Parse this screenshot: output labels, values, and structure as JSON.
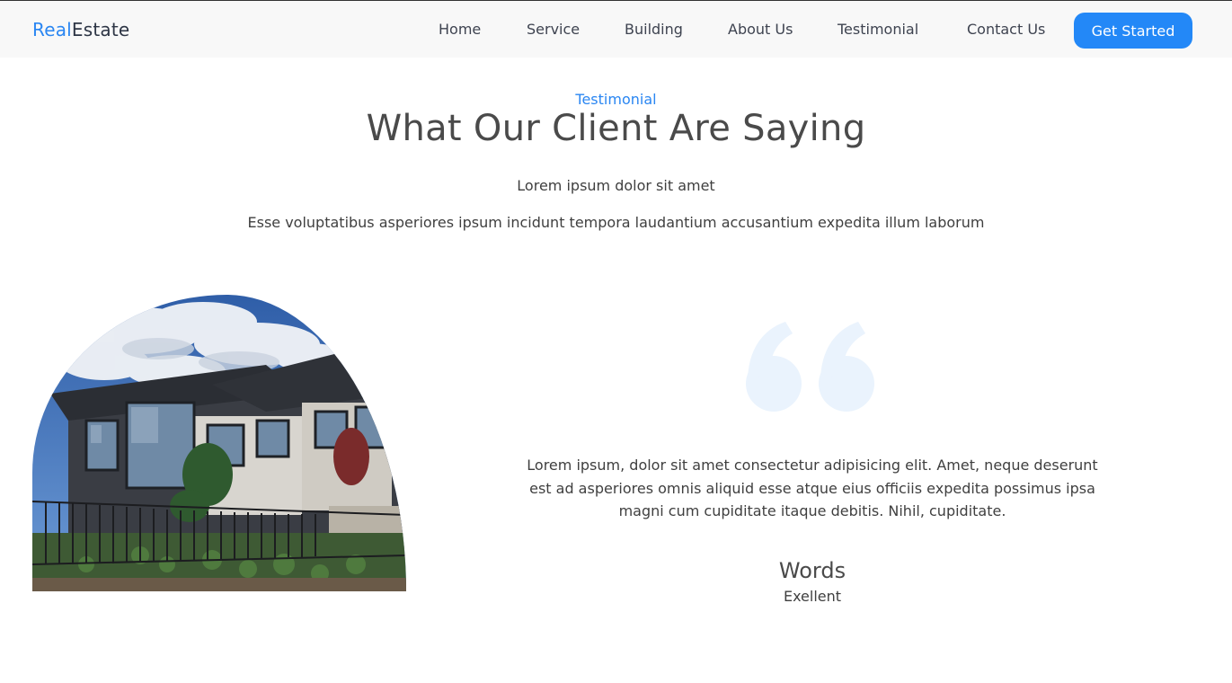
{
  "brand": {
    "part1": "Real",
    "part2": "Estate",
    "accent_color": "#2a86f2"
  },
  "nav": {
    "links": [
      "Home",
      "Service",
      "Building",
      "About Us",
      "Testimonial",
      "Contact Us"
    ],
    "cta": "Get Started",
    "cta_color": "#2388f7"
  },
  "section": {
    "eyebrow": "Testimonial",
    "title": "What Our Client Are Saying",
    "subtitle": "Lorem ipsum dolor sit amet",
    "description": "Esse voluptatibus asperiores ipsum incidunt tempora laudantium accusantium expedita illum laborum"
  },
  "testimonial": {
    "quote_icon": "quote-icon",
    "text": "Lorem ipsum, dolor sit amet consectetur adipisicing elit. Amet, neque deserunt est ad asperiores omnis aliquid esse atque eius officiis expedita possimus ipsa magni cum cupiditate itaque debitis. Nihil, cupiditate.",
    "author": "Words",
    "role": "Exellent"
  }
}
